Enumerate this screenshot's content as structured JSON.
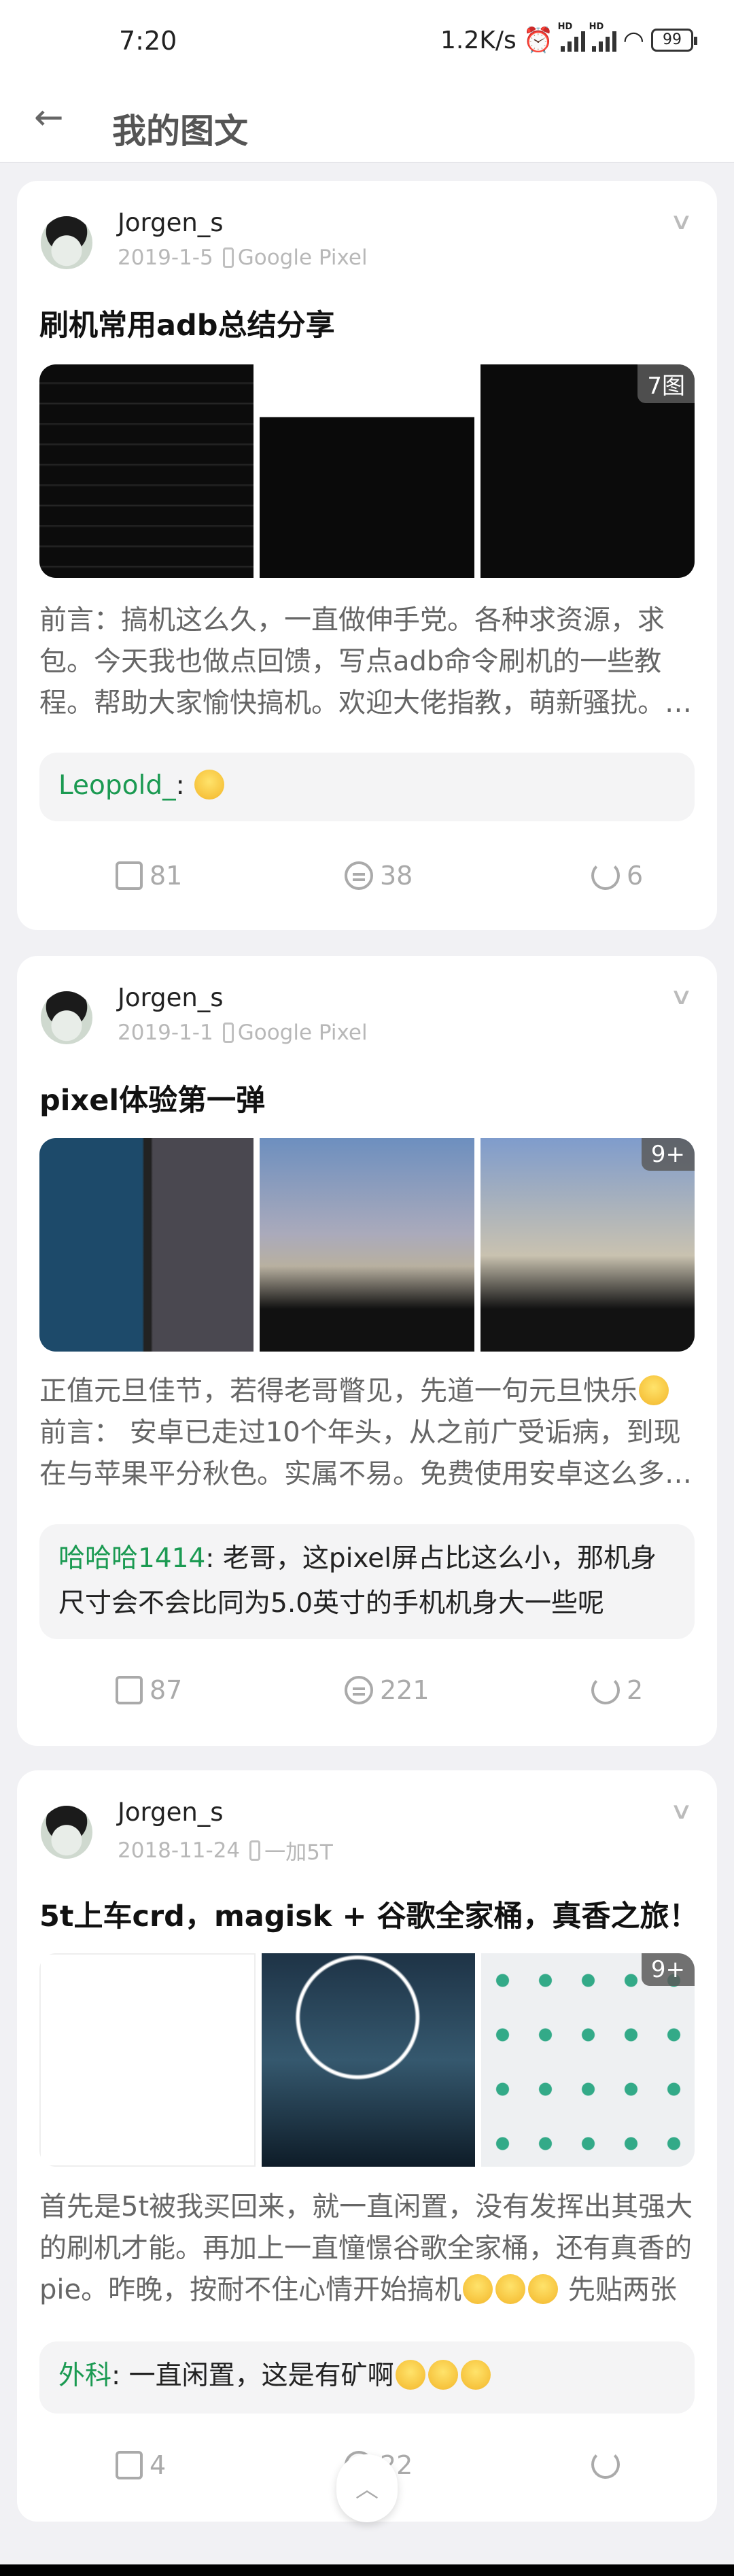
{
  "status_bar": {
    "time": "7:20",
    "net_speed": "1.2K/s",
    "battery": "99",
    "hd": "HD"
  },
  "header": {
    "title": "我的图文"
  },
  "posts": [
    {
      "author": "Jorgen_s",
      "date": "2019-1-5",
      "device": "Google Pixel",
      "title": "刷机常用adb总结分享",
      "image_count_badge": "7图",
      "body": "前言：搞机这么久，一直做伸手党。各种求资源，求包。今天我也做点回馈，写点adb命令刷机的一些教程。帮助大家愉快搞机。欢迎大佬指教，萌新骚扰。进步",
      "comment": {
        "user": "Leopold_",
        "text": ""
      },
      "likes": "81",
      "comments": "38",
      "shares": "6"
    },
    {
      "author": "Jorgen_s",
      "date": "2019-1-1",
      "device": "Google Pixel",
      "title": "pixel体验第一弹",
      "image_count_badge": "9+",
      "body_a": "正值元旦佳节，若得老哥瞥见，先道一句元旦快乐",
      "body_b": " 前言： 安卓已走过10个年头，从之前广受诟病，到现在与苹果平分秋色。实属不易。免费使用安卓这么多年了",
      "comment": {
        "user": "哈哈哈1414",
        "text": "老哥，这pixel屏占比这么小，那机身尺寸会不会比同为5.0英寸的手机机身大一些呢"
      },
      "likes": "87",
      "comments": "221",
      "shares": "2"
    },
    {
      "author": "Jorgen_s",
      "date": "2018-11-24",
      "device": "一加5T",
      "title": "5t上车crd，magisk + 谷歌全家桶，真香之旅！",
      "image_count_badge": "9+",
      "body_a": "首先是5t被我买回来，就一直闲置，没有发挥出其强大的刷机才能。再加上一直憧憬谷歌全家桶，还有真香的pie。昨晚，按耐不住心情开始搞机",
      "body_b": " 先贴两张",
      "comment": {
        "user": "外科",
        "text": "一直闲置，这是有矿啊"
      },
      "likes": "4",
      "comments": "22",
      "shares": ""
    }
  ],
  "colors": {
    "commenter": "#1b9a52",
    "background": "#f1f1f4"
  }
}
